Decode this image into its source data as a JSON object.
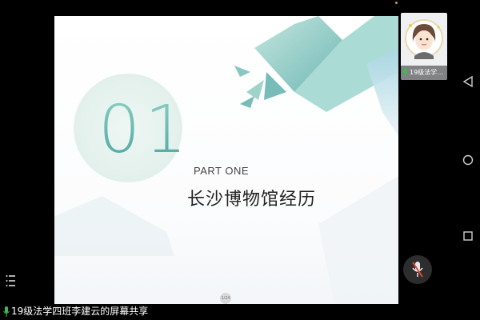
{
  "slide": {
    "number": "01",
    "part_label": "PART ONE",
    "title": "长沙博物馆经历",
    "page_indicator": "1/24"
  },
  "participant": {
    "name": "19级法学…",
    "mic": "on"
  },
  "status_bar": {
    "text": "19级法学四班李建云的屏幕共享"
  },
  "icons": {
    "back": "back-triangle-icon",
    "home": "home-circle-icon",
    "recents": "recents-square-icon",
    "menu": "hamburger-menu-icon",
    "mic_off": "microphone-muted-icon",
    "mic_on": "microphone-icon"
  },
  "colors": {
    "accent_teal": "#4aa4a0",
    "mic_green": "#3dbb4f",
    "mute_red": "#e24a3b"
  }
}
